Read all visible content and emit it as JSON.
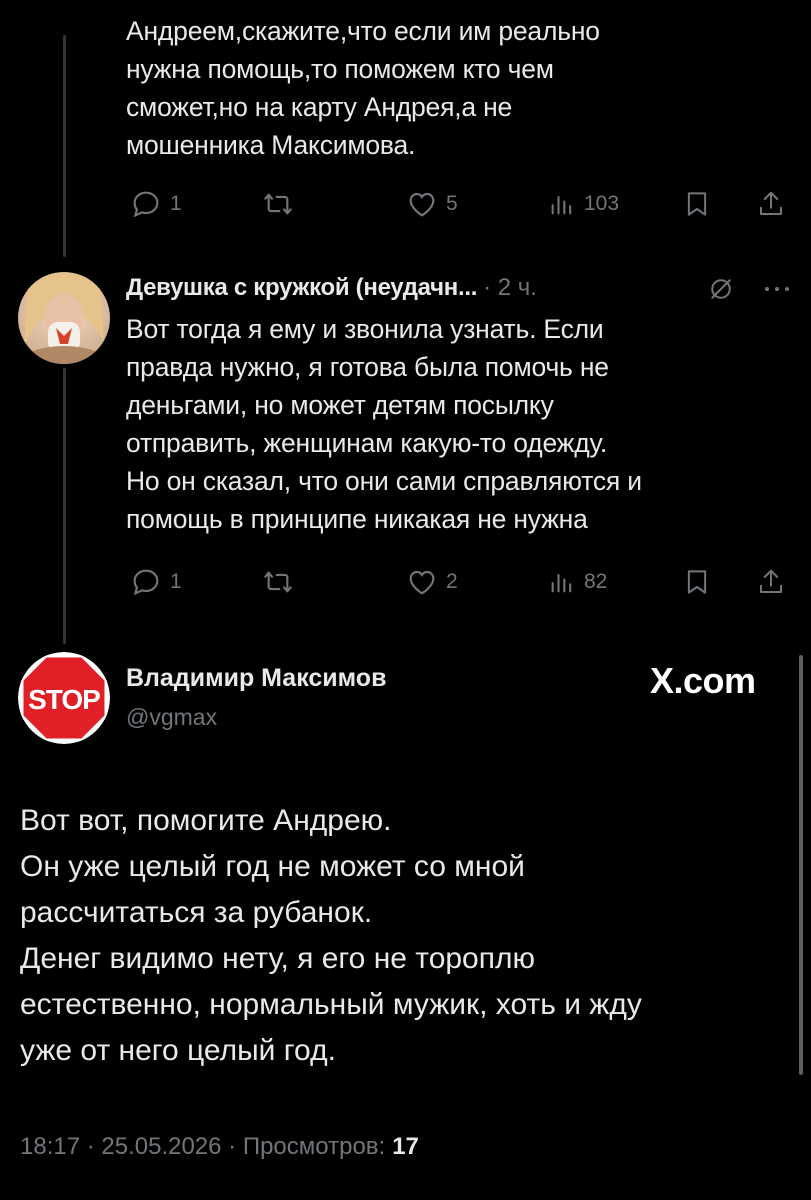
{
  "tweet1": {
    "text_lines": [
      "Андреем,скажите,что если им реально",
      "нужна помощь,то поможем кто чем",
      "сможет,но на карту Андрея,а не",
      "мошенника Максимова."
    ],
    "actions": {
      "replies": "1",
      "likes": "5",
      "views": "103"
    }
  },
  "tweet2": {
    "author_name": "Девушка с кружкой (неудачн...",
    "time": "· 2 ч.",
    "text_lines": [
      "Вот тогда я ему и звонила узнать. Если",
      "правда нужно, я готова была помочь не",
      "деньгами, но может детям посылку",
      "отправить, женщинам какую-то одежду.",
      "Но он сказал, что они сами справляются и",
      "помощь в принципе никакая не нужна"
    ],
    "actions": {
      "replies": "1",
      "likes": "2",
      "views": "82"
    }
  },
  "main_tweet": {
    "author_name": "Владимир Максимов",
    "handle": "@vgmax",
    "avatar_text": "STOP",
    "brand": "X.com",
    "text_lines": [
      "Вот вот, помогите Андрею.",
      "Он уже целый год не может со мной",
      "рассчитаться за рубанок.",
      "Денег видимо нету, я его не тороплю",
      "естественно, нормальный мужик, хоть и жду",
      "уже от него целый год."
    ],
    "footer": {
      "timestamp": "18:17 · 25.05.2026 · Просмотров:",
      "views": "17"
    }
  },
  "icons": {
    "reply": "reply-icon",
    "retweet": "retweet-icon",
    "like": "heart-icon",
    "views": "views-icon",
    "bookmark": "bookmark-icon",
    "share": "share-icon",
    "grok": "grok-icon",
    "more": "more-icon"
  },
  "colors": {
    "background": "#000000",
    "text": "#e7e9ea",
    "secondary": "#71767b",
    "stop_red": "#e01f26"
  }
}
